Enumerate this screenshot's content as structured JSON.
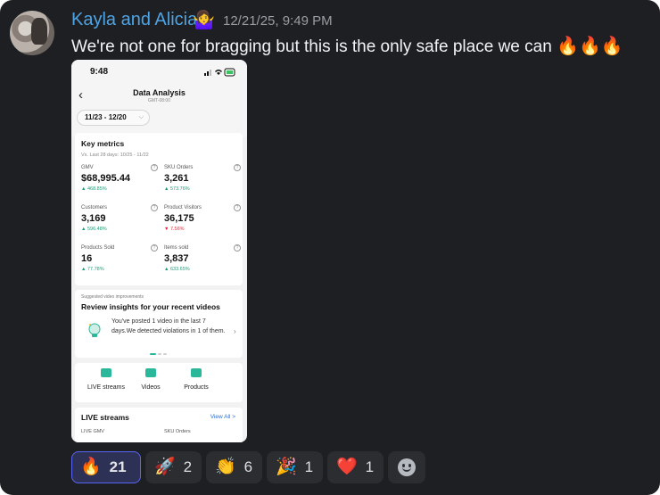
{
  "message": {
    "author": "Kayla and Alicia",
    "author_emoji": "🤷‍♀️",
    "timestamp": "12/21/25, 9:49 PM",
    "text": "We're not one for bragging but this is the only safe place we can",
    "trailing_emoji": "🔥🔥🔥"
  },
  "screenshot": {
    "time": "9:48",
    "title": "Data Analysis",
    "subtitle": "GMT-08:00",
    "date_range": "11/23 - 12/20",
    "key_metrics": {
      "title": "Key metrics",
      "comparison": "Vs. Last 28 days: 10/25 - 11/22",
      "items": [
        {
          "label": "GMV",
          "value": "$68,995.44",
          "change": "▲ 468.85%",
          "trend": "up"
        },
        {
          "label": "SKU Orders",
          "value": "3,261",
          "change": "▲ 573.76%",
          "trend": "up"
        },
        {
          "label": "Customers",
          "value": "3,169",
          "change": "▲ 596.48%",
          "trend": "up"
        },
        {
          "label": "Product Visitors",
          "value": "36,175",
          "change": "▼ 7.56%",
          "trend": "down"
        },
        {
          "label": "Products Sold",
          "value": "16",
          "change": "▲ 77.78%",
          "trend": "up"
        },
        {
          "label": "Items sold",
          "value": "3,837",
          "change": "▲ 633.65%",
          "trend": "up"
        }
      ]
    },
    "insights": {
      "tag": "Suggested video improvements",
      "title": "Review insights for your recent videos",
      "body": "You've posted 1 video in the last 7 days.We detected violations in 1 of them."
    },
    "shortcuts": [
      "LIVE streams",
      "Videos",
      "Products"
    ],
    "live": {
      "title": "LIVE streams",
      "view_all": "View All >",
      "columns": [
        "LIVE GMV",
        "SKU Orders"
      ]
    }
  },
  "reactions": [
    {
      "emoji": "🔥",
      "count": "21",
      "active": true
    },
    {
      "emoji": "🚀",
      "count": "2",
      "active": false
    },
    {
      "emoji": "👏",
      "count": "6",
      "active": false
    },
    {
      "emoji": "🎉",
      "count": "1",
      "active": false
    },
    {
      "emoji": "❤️",
      "count": "1",
      "active": false
    }
  ],
  "colors": {
    "background": "#1e1f22",
    "author": "#4fa3e3",
    "active_reaction_border": "#5865f2",
    "metric_up": "#1a9d7a",
    "metric_down": "#e0283a"
  }
}
